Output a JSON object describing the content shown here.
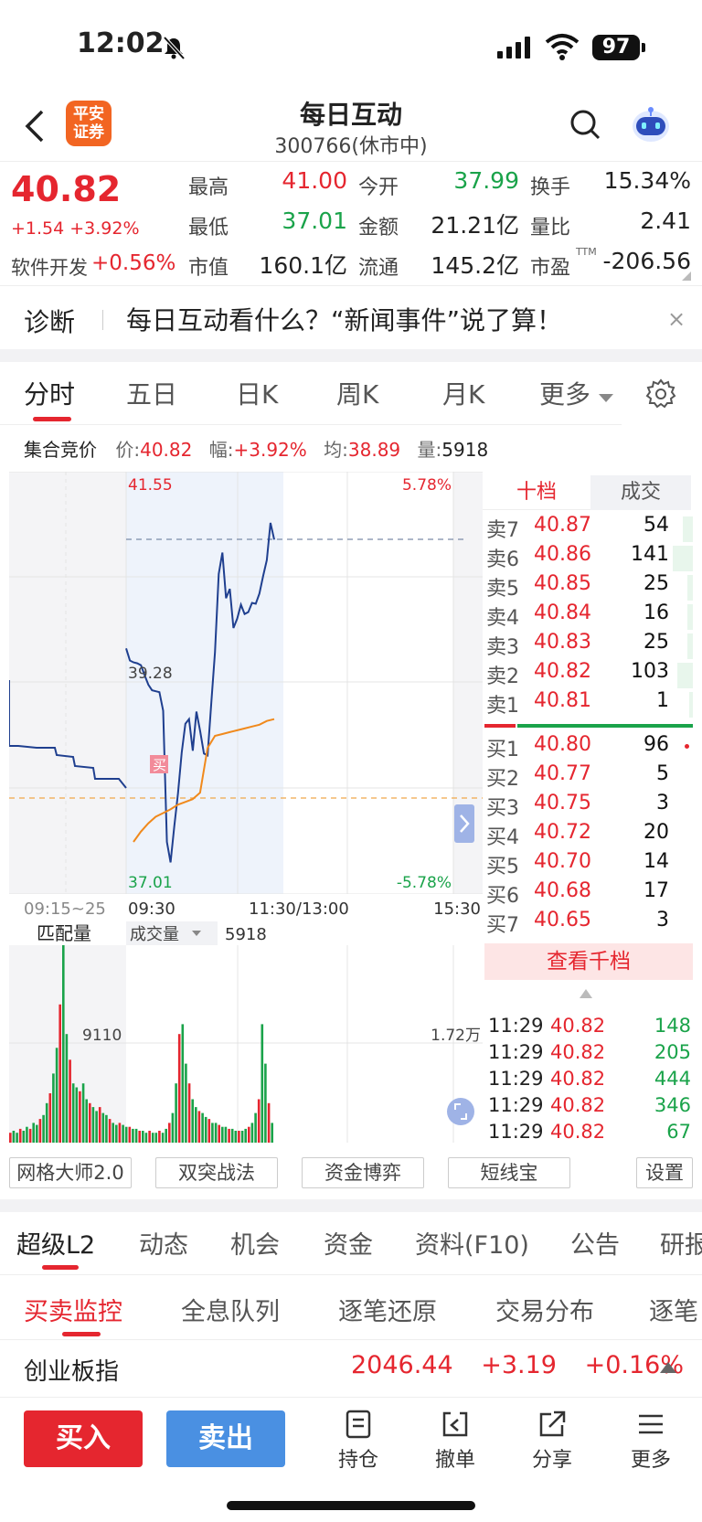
{
  "status": {
    "time": "12:02",
    "battery": "97"
  },
  "header": {
    "logo_line1": "平安",
    "logo_line2": "证券",
    "name": "每日互动",
    "code": "300766(休市中)"
  },
  "quote": {
    "price": "40.82",
    "change": "+1.54 +3.92%",
    "sector_name": "软件开发",
    "sector_pct": "+0.56%",
    "fields": [
      {
        "label": "最高",
        "value": "41.00",
        "color": "#e5262f"
      },
      {
        "label": "今开",
        "value": "37.99",
        "color": "#1aa34a"
      },
      {
        "label": "换手",
        "value": "15.34%",
        "color": "#222222"
      },
      {
        "label": "最低",
        "value": "37.01",
        "color": "#1aa34a"
      },
      {
        "label": "金额",
        "value": "21.21亿",
        "color": "#222222"
      },
      {
        "label": "量比",
        "value": "2.41",
        "color": "#222222"
      },
      {
        "label": "市值",
        "value": "160.1亿",
        "color": "#222222"
      },
      {
        "label": "流通",
        "value": "145.2亿",
        "color": "#222222"
      },
      {
        "label": "市盈",
        "value": "-206.56",
        "color": "#222222",
        "sup": "TTM"
      }
    ]
  },
  "diagnosis": {
    "label": "诊断",
    "text": "每日互动看什么？“新闻事件”说了算！",
    "close": "×"
  },
  "period_tabs": [
    "分时",
    "五日",
    "日K",
    "周K",
    "月K",
    "更多"
  ],
  "info_line": {
    "section": "集合竞价",
    "price_label": "价:",
    "price": "40.82",
    "amp_label": "幅:",
    "amp": "+3.92%",
    "avg_label": "均:",
    "avg": "38.89",
    "vol_label": "量:",
    "vol": "5918"
  },
  "chart_labels": {
    "top_price": "41.55",
    "top_pct": "5.78%",
    "mid_price": "39.28",
    "bottom_price": "37.01",
    "bottom_pct": "-5.78%",
    "t_auction": "09:15~25",
    "t_open": "09:30",
    "t_mid": "11:30/13:00",
    "t_close": "15:30",
    "match_label": "匹配量",
    "vol_selector": "成交量",
    "vol_value": "5918",
    "vol_mid_left": "9110",
    "vol_mid_right": "1.72万",
    "buy_marker": "买"
  },
  "chart_data": {
    "type": "line",
    "title": "",
    "ylim": [
      37.01,
      41.55
    ],
    "prev_close": 39.28,
    "price_series": [
      39.65,
      39.52,
      39.5,
      39.49,
      39.47,
      39.36,
      39.26,
      39.2,
      39.19,
      39.18,
      38.98,
      37.57,
      37.35,
      37.74,
      38.09,
      38.53,
      38.84,
      38.89,
      38.55,
      38.97,
      38.76,
      38.52,
      38.5,
      39.07,
      39.61,
      40.45,
      40.68,
      40.19,
      40.29,
      39.87,
      39.97,
      40.12,
      40.02,
      40.04,
      40.14,
      40.13,
      40.24,
      40.43,
      40.6,
      41.0,
      40.82
    ],
    "avg_series": [
      37.57,
      37.68,
      37.77,
      37.84,
      37.88,
      37.92,
      37.97,
      38.0,
      38.03,
      38.1,
      38.58,
      38.71,
      38.73,
      38.75,
      38.77,
      38.79,
      38.81,
      38.83,
      38.87,
      38.89
    ],
    "volume_note": "volume bars read from chart, relative height 0-1",
    "volume_series": [
      0.05,
      0.06,
      0.05,
      0.07,
      0.06,
      0.08,
      0.07,
      0.1,
      0.09,
      0.12,
      0.14,
      0.2,
      0.25,
      0.35,
      0.48,
      0.7,
      1.0,
      0.55,
      0.42,
      0.3,
      0.28,
      0.26,
      0.3,
      0.22,
      0.2,
      0.18,
      0.16,
      0.18,
      0.15,
      0.14,
      0.12,
      0.1,
      0.09,
      0.1,
      0.09,
      0.08,
      0.08,
      0.07,
      0.07,
      0.06,
      0.06,
      0.05,
      0.06,
      0.05,
      0.05,
      0.06,
      0.05,
      0.07,
      0.1,
      0.15,
      0.3,
      0.55,
      0.6,
      0.4,
      0.3,
      0.22,
      0.18,
      0.16,
      0.15,
      0.13,
      0.12,
      0.1,
      0.1,
      0.09,
      0.08,
      0.08,
      0.07,
      0.07,
      0.06,
      0.06,
      0.06,
      0.07,
      0.08,
      0.1,
      0.15,
      0.22,
      0.6,
      0.4,
      0.2,
      0.1
    ]
  },
  "order_book": {
    "head_left": "十档",
    "head_right": "成交",
    "asks": [
      {
        "label": "卖7",
        "price": "40.87",
        "vol": "54",
        "bar": 0.1
      },
      {
        "label": "卖6",
        "price": "40.86",
        "vol": "141",
        "bar": 0.2
      },
      {
        "label": "卖5",
        "price": "40.85",
        "vol": "25",
        "bar": 0.05
      },
      {
        "label": "卖4",
        "price": "40.84",
        "vol": "16",
        "bar": 0.05
      },
      {
        "label": "卖3",
        "price": "40.83",
        "vol": "25",
        "bar": 0.05
      },
      {
        "label": "卖2",
        "price": "40.82",
        "vol": "103",
        "bar": 0.15
      },
      {
        "label": "卖1",
        "price": "40.81",
        "vol": "1",
        "bar": 0.02
      }
    ],
    "bids": [
      {
        "label": "买1",
        "price": "40.80",
        "vol": "96"
      },
      {
        "label": "买2",
        "price": "40.77",
        "vol": "5"
      },
      {
        "label": "买3",
        "price": "40.75",
        "vol": "3"
      },
      {
        "label": "买4",
        "price": "40.72",
        "vol": "20"
      },
      {
        "label": "买5",
        "price": "40.70",
        "vol": "14"
      },
      {
        "label": "买6",
        "price": "40.68",
        "vol": "17"
      },
      {
        "label": "买7",
        "price": "40.65",
        "vol": "3"
      }
    ],
    "more_button": "查看千档",
    "ticks": [
      {
        "time": "11:29",
        "price": "40.82",
        "vol": "148"
      },
      {
        "time": "11:29",
        "price": "40.82",
        "vol": "205"
      },
      {
        "time": "11:29",
        "price": "40.82",
        "vol": "444"
      },
      {
        "time": "11:29",
        "price": "40.82",
        "vol": "346"
      },
      {
        "time": "11:29",
        "price": "40.82",
        "vol": "67"
      }
    ]
  },
  "tools": [
    "网格大师2.0",
    "双突战法",
    "资金博弈",
    "短线宝",
    "设置"
  ],
  "big_tabs": [
    "超级L2",
    "动态",
    "机会",
    "资金",
    "资料(F10)",
    "公告",
    "研报"
  ],
  "sub_tabs": [
    "买卖监控",
    "全息队列",
    "逐笔还原",
    "交易分布",
    "逐笔"
  ],
  "index_bar": {
    "name": "创业板指",
    "value": "2046.44",
    "change": "+3.19",
    "pct": "+0.16%"
  },
  "actions": {
    "buy": "买入",
    "sell": "卖出",
    "items": [
      "持仓",
      "撤单",
      "分享",
      "更多"
    ]
  },
  "colors": {
    "up": "#e5262f",
    "down": "#1aa34a",
    "price_line": "#1f3f8f",
    "avg_line": "#f0891c"
  }
}
